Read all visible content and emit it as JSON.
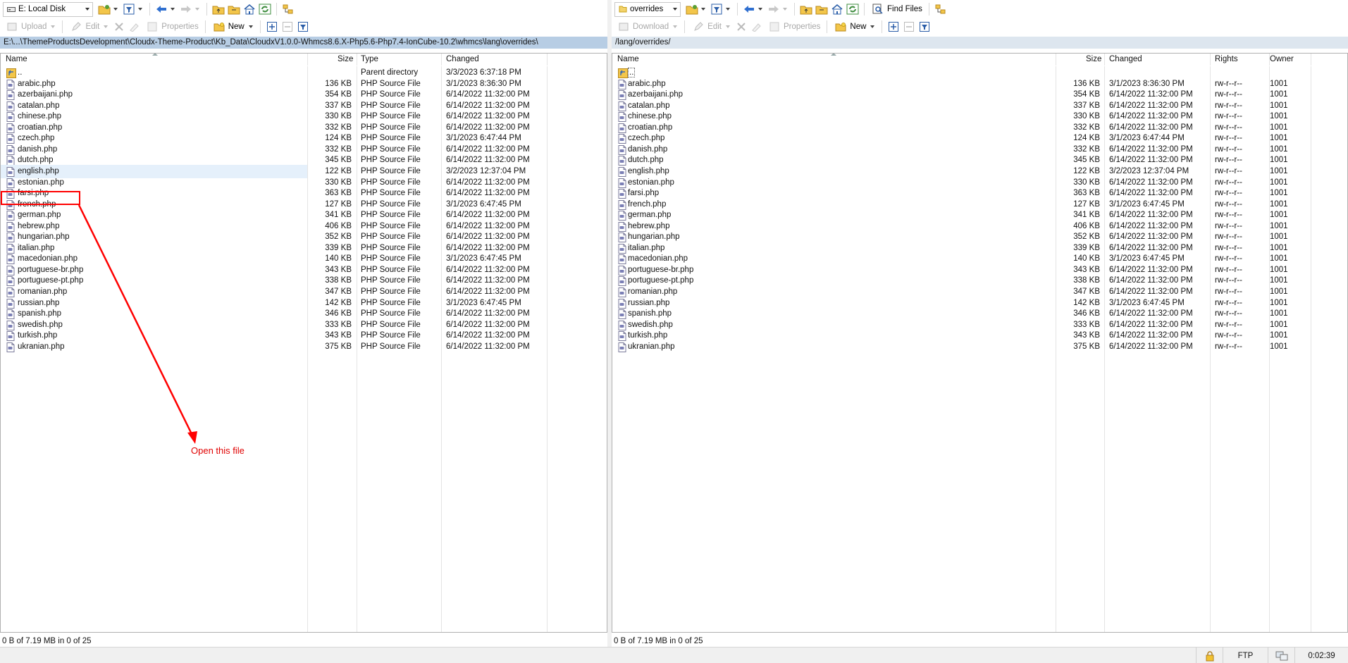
{
  "left": {
    "drive_label": "E: Local Disk",
    "toolbar2": {
      "upload": "Upload",
      "edit": "Edit",
      "properties": "Properties",
      "new": "New"
    },
    "path": "E:\\...\\ThemeProductsDevelopment\\Cloudx-Theme-Product\\Kb_Data\\CloudxV1.0.0-Whmcs8.6.X-Php5.6-Php7.4-IonCube-10.2\\whmcs\\lang\\overrides\\",
    "columns": {
      "name": "Name",
      "size": "Size",
      "type": "Type",
      "changed": "Changed"
    },
    "parent": {
      "name": "..",
      "type": "Parent directory",
      "changed": "3/3/2023  6:37:18 PM"
    },
    "files": [
      {
        "name": "arabic.php",
        "size": "136 KB",
        "type": "PHP Source File",
        "changed": "3/1/2023  8:36:30 PM"
      },
      {
        "name": "azerbaijani.php",
        "size": "354 KB",
        "type": "PHP Source File",
        "changed": "6/14/2022  11:32:00 PM"
      },
      {
        "name": "catalan.php",
        "size": "337 KB",
        "type": "PHP Source File",
        "changed": "6/14/2022  11:32:00 PM"
      },
      {
        "name": "chinese.php",
        "size": "330 KB",
        "type": "PHP Source File",
        "changed": "6/14/2022  11:32:00 PM"
      },
      {
        "name": "croatian.php",
        "size": "332 KB",
        "type": "PHP Source File",
        "changed": "6/14/2022  11:32:00 PM"
      },
      {
        "name": "czech.php",
        "size": "124 KB",
        "type": "PHP Source File",
        "changed": "3/1/2023  6:47:44 PM"
      },
      {
        "name": "danish.php",
        "size": "332 KB",
        "type": "PHP Source File",
        "changed": "6/14/2022  11:32:00 PM"
      },
      {
        "name": "dutch.php",
        "size": "345 KB",
        "type": "PHP Source File",
        "changed": "6/14/2022  11:32:00 PM"
      },
      {
        "name": "english.php",
        "size": "122 KB",
        "type": "PHP Source File",
        "changed": "3/2/2023  12:37:04 PM"
      },
      {
        "name": "estonian.php",
        "size": "330 KB",
        "type": "PHP Source File",
        "changed": "6/14/2022  11:32:00 PM"
      },
      {
        "name": "farsi.php",
        "size": "363 KB",
        "type": "PHP Source File",
        "changed": "6/14/2022  11:32:00 PM"
      },
      {
        "name": "french.php",
        "size": "127 KB",
        "type": "PHP Source File",
        "changed": "3/1/2023  6:47:45 PM"
      },
      {
        "name": "german.php",
        "size": "341 KB",
        "type": "PHP Source File",
        "changed": "6/14/2022  11:32:00 PM"
      },
      {
        "name": "hebrew.php",
        "size": "406 KB",
        "type": "PHP Source File",
        "changed": "6/14/2022  11:32:00 PM"
      },
      {
        "name": "hungarian.php",
        "size": "352 KB",
        "type": "PHP Source File",
        "changed": "6/14/2022  11:32:00 PM"
      },
      {
        "name": "italian.php",
        "size": "339 KB",
        "type": "PHP Source File",
        "changed": "6/14/2022  11:32:00 PM"
      },
      {
        "name": "macedonian.php",
        "size": "140 KB",
        "type": "PHP Source File",
        "changed": "3/1/2023  6:47:45 PM"
      },
      {
        "name": "portuguese-br.php",
        "size": "343 KB",
        "type": "PHP Source File",
        "changed": "6/14/2022  11:32:00 PM"
      },
      {
        "name": "portuguese-pt.php",
        "size": "338 KB",
        "type": "PHP Source File",
        "changed": "6/14/2022  11:32:00 PM"
      },
      {
        "name": "romanian.php",
        "size": "347 KB",
        "type": "PHP Source File",
        "changed": "6/14/2022  11:32:00 PM"
      },
      {
        "name": "russian.php",
        "size": "142 KB",
        "type": "PHP Source File",
        "changed": "3/1/2023  6:47:45 PM"
      },
      {
        "name": "spanish.php",
        "size": "346 KB",
        "type": "PHP Source File",
        "changed": "6/14/2022  11:32:00 PM"
      },
      {
        "name": "swedish.php",
        "size": "333 KB",
        "type": "PHP Source File",
        "changed": "6/14/2022  11:32:00 PM"
      },
      {
        "name": "turkish.php",
        "size": "343 KB",
        "type": "PHP Source File",
        "changed": "6/14/2022  11:32:00 PM"
      },
      {
        "name": "ukranian.php",
        "size": "375 KB",
        "type": "PHP Source File",
        "changed": "6/14/2022  11:32:00 PM"
      }
    ],
    "status": "0 B of 7.19 MB in 0 of 25"
  },
  "right": {
    "folder_label": "overrides",
    "find_files": "Find Files",
    "toolbar2": {
      "download": "Download",
      "edit": "Edit",
      "properties": "Properties",
      "new": "New"
    },
    "path": "/lang/overrides/",
    "columns": {
      "name": "Name",
      "size": "Size",
      "changed": "Changed",
      "rights": "Rights",
      "owner": "Owner"
    },
    "parent": {
      "name": ".."
    },
    "files": [
      {
        "name": "arabic.php",
        "size": "136 KB",
        "changed": "3/1/2023 8:36:30 PM",
        "rights": "rw-r--r--",
        "owner": "1001"
      },
      {
        "name": "azerbaijani.php",
        "size": "354 KB",
        "changed": "6/14/2022 11:32:00 PM",
        "rights": "rw-r--r--",
        "owner": "1001"
      },
      {
        "name": "catalan.php",
        "size": "337 KB",
        "changed": "6/14/2022 11:32:00 PM",
        "rights": "rw-r--r--",
        "owner": "1001"
      },
      {
        "name": "chinese.php",
        "size": "330 KB",
        "changed": "6/14/2022 11:32:00 PM",
        "rights": "rw-r--r--",
        "owner": "1001"
      },
      {
        "name": "croatian.php",
        "size": "332 KB",
        "changed": "6/14/2022 11:32:00 PM",
        "rights": "rw-r--r--",
        "owner": "1001"
      },
      {
        "name": "czech.php",
        "size": "124 KB",
        "changed": "3/1/2023 6:47:44 PM",
        "rights": "rw-r--r--",
        "owner": "1001"
      },
      {
        "name": "danish.php",
        "size": "332 KB",
        "changed": "6/14/2022 11:32:00 PM",
        "rights": "rw-r--r--",
        "owner": "1001"
      },
      {
        "name": "dutch.php",
        "size": "345 KB",
        "changed": "6/14/2022 11:32:00 PM",
        "rights": "rw-r--r--",
        "owner": "1001"
      },
      {
        "name": "english.php",
        "size": "122 KB",
        "changed": "3/2/2023 12:37:04 PM",
        "rights": "rw-r--r--",
        "owner": "1001"
      },
      {
        "name": "estonian.php",
        "size": "330 KB",
        "changed": "6/14/2022 11:32:00 PM",
        "rights": "rw-r--r--",
        "owner": "1001"
      },
      {
        "name": "farsi.php",
        "size": "363 KB",
        "changed": "6/14/2022 11:32:00 PM",
        "rights": "rw-r--r--",
        "owner": "1001"
      },
      {
        "name": "french.php",
        "size": "127 KB",
        "changed": "3/1/2023 6:47:45 PM",
        "rights": "rw-r--r--",
        "owner": "1001"
      },
      {
        "name": "german.php",
        "size": "341 KB",
        "changed": "6/14/2022 11:32:00 PM",
        "rights": "rw-r--r--",
        "owner": "1001"
      },
      {
        "name": "hebrew.php",
        "size": "406 KB",
        "changed": "6/14/2022 11:32:00 PM",
        "rights": "rw-r--r--",
        "owner": "1001"
      },
      {
        "name": "hungarian.php",
        "size": "352 KB",
        "changed": "6/14/2022 11:32:00 PM",
        "rights": "rw-r--r--",
        "owner": "1001"
      },
      {
        "name": "italian.php",
        "size": "339 KB",
        "changed": "6/14/2022 11:32:00 PM",
        "rights": "rw-r--r--",
        "owner": "1001"
      },
      {
        "name": "macedonian.php",
        "size": "140 KB",
        "changed": "3/1/2023 6:47:45 PM",
        "rights": "rw-r--r--",
        "owner": "1001"
      },
      {
        "name": "portuguese-br.php",
        "size": "343 KB",
        "changed": "6/14/2022 11:32:00 PM",
        "rights": "rw-r--r--",
        "owner": "1001"
      },
      {
        "name": "portuguese-pt.php",
        "size": "338 KB",
        "changed": "6/14/2022 11:32:00 PM",
        "rights": "rw-r--r--",
        "owner": "1001"
      },
      {
        "name": "romanian.php",
        "size": "347 KB",
        "changed": "6/14/2022 11:32:00 PM",
        "rights": "rw-r--r--",
        "owner": "1001"
      },
      {
        "name": "russian.php",
        "size": "142 KB",
        "changed": "3/1/2023 6:47:45 PM",
        "rights": "rw-r--r--",
        "owner": "1001"
      },
      {
        "name": "spanish.php",
        "size": "346 KB",
        "changed": "6/14/2022 11:32:00 PM",
        "rights": "rw-r--r--",
        "owner": "1001"
      },
      {
        "name": "swedish.php",
        "size": "333 KB",
        "changed": "6/14/2022 11:32:00 PM",
        "rights": "rw-r--r--",
        "owner": "1001"
      },
      {
        "name": "turkish.php",
        "size": "343 KB",
        "changed": "6/14/2022 11:32:00 PM",
        "rights": "rw-r--r--",
        "owner": "1001"
      },
      {
        "name": "ukranian.php",
        "size": "375 KB",
        "changed": "6/14/2022 11:32:00 PM",
        "rights": "rw-r--r--",
        "owner": "1001"
      }
    ],
    "status": "0 B of 7.19 MB in 0 of 25"
  },
  "selected_file": "english.php",
  "annotation": {
    "text": "Open this file",
    "color": "#ff0000"
  },
  "statusbar": {
    "protocol": "FTP",
    "elapsed": "0:02:39"
  },
  "icons": {
    "drive": "drive-icon",
    "open_folder": "open-folder-icon",
    "filter": "filter-icon",
    "back": "back-arrow-icon",
    "forward": "forward-arrow-icon",
    "parent": "parent-folder-icon",
    "root": "root-folder-icon",
    "home": "home-icon",
    "refresh": "refresh-icon",
    "tree": "tree-icon",
    "find": "find-files-icon",
    "lock": "lock-icon",
    "php_file": "php-file-icon"
  }
}
